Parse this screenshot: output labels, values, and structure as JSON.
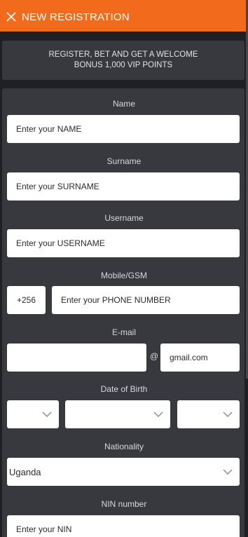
{
  "header": {
    "title": "NEW REGISTRATION",
    "bg_color": "#f26b1d",
    "close_icon": "close-icon"
  },
  "banner": {
    "line1": "REGISTER, BET AND GET A WELCOME",
    "line2": "BONUS 1,000 VIP POINTS"
  },
  "form": {
    "name": {
      "label": "Name",
      "placeholder": "Enter your NAME"
    },
    "surname": {
      "label": "Surname",
      "placeholder": "Enter your SURNAME"
    },
    "username": {
      "label": "Username",
      "placeholder": "Enter your USERNAME"
    },
    "mobile": {
      "label": "Mobile/GSM",
      "prefix": "+256",
      "placeholder": "Enter your PHONE NUMBER"
    },
    "email": {
      "label": "E-mail",
      "at": "@",
      "domain": "gmail.com",
      "value": ""
    },
    "dob": {
      "label": "Date of Birth",
      "day": "",
      "month": "",
      "year": ""
    },
    "nationality": {
      "label": "Nationality",
      "value": "Uganda"
    },
    "nin": {
      "label": "NIN number",
      "placeholder": "Enter your NIN"
    }
  }
}
